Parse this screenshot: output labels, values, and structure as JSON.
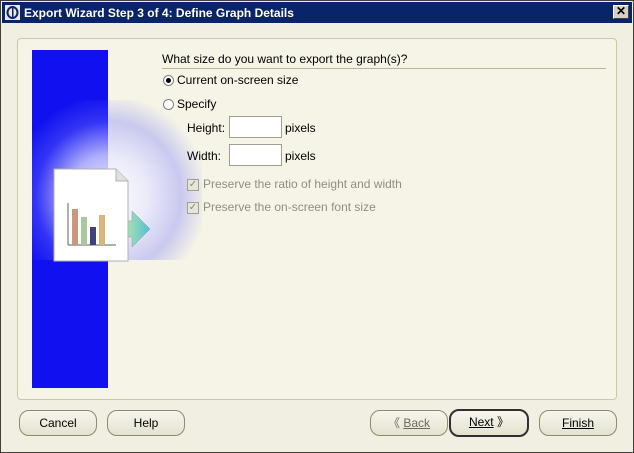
{
  "window": {
    "title": "Export Wizard Step 3 of 4: Define Graph Details",
    "close_glyph": "✕"
  },
  "panel": {
    "heading": "What size do you want to export the graph(s)?",
    "options": {
      "current": {
        "label": "Current on-screen size",
        "checked": true
      },
      "specify": {
        "label": "Specify",
        "checked": false
      }
    },
    "height": {
      "label": "Height:",
      "value": "",
      "unit": "pixels"
    },
    "width": {
      "label": "Width:",
      "value": "",
      "unit": "pixels"
    },
    "checkboxes": {
      "ratio": {
        "label": "Preserve the ratio of height and width",
        "checked": true,
        "enabled": false
      },
      "font": {
        "label": "Preserve the on-screen font size",
        "checked": true,
        "enabled": false
      }
    }
  },
  "buttons": {
    "cancel": "Cancel",
    "help": "Help",
    "back": "Back",
    "next": "Next",
    "finish": "Finish",
    "back_chevron": "《",
    "next_chevron": "》"
  },
  "colors": {
    "titlebar": "#0a246a",
    "sidebar": "#1010f0",
    "dialog_bg": "#f0efe2"
  }
}
